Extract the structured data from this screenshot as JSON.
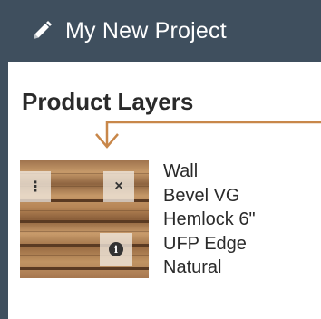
{
  "header": {
    "title": "My New Project",
    "icon": "pencil-icon",
    "background": "#3f4f5e"
  },
  "section": {
    "title": "Product Layers"
  },
  "layer": {
    "thumbnail_icon": "wood-texture",
    "menu_glyph": "⋮",
    "remove_glyph": "×",
    "info_glyph": "i",
    "details": [
      "Wall",
      "Bevel VG",
      "Hemlock 6\"",
      "UFP Edge",
      "Natural"
    ]
  },
  "colors": {
    "accent_arrow": "#c8874a",
    "text": "#2a2a2a"
  }
}
